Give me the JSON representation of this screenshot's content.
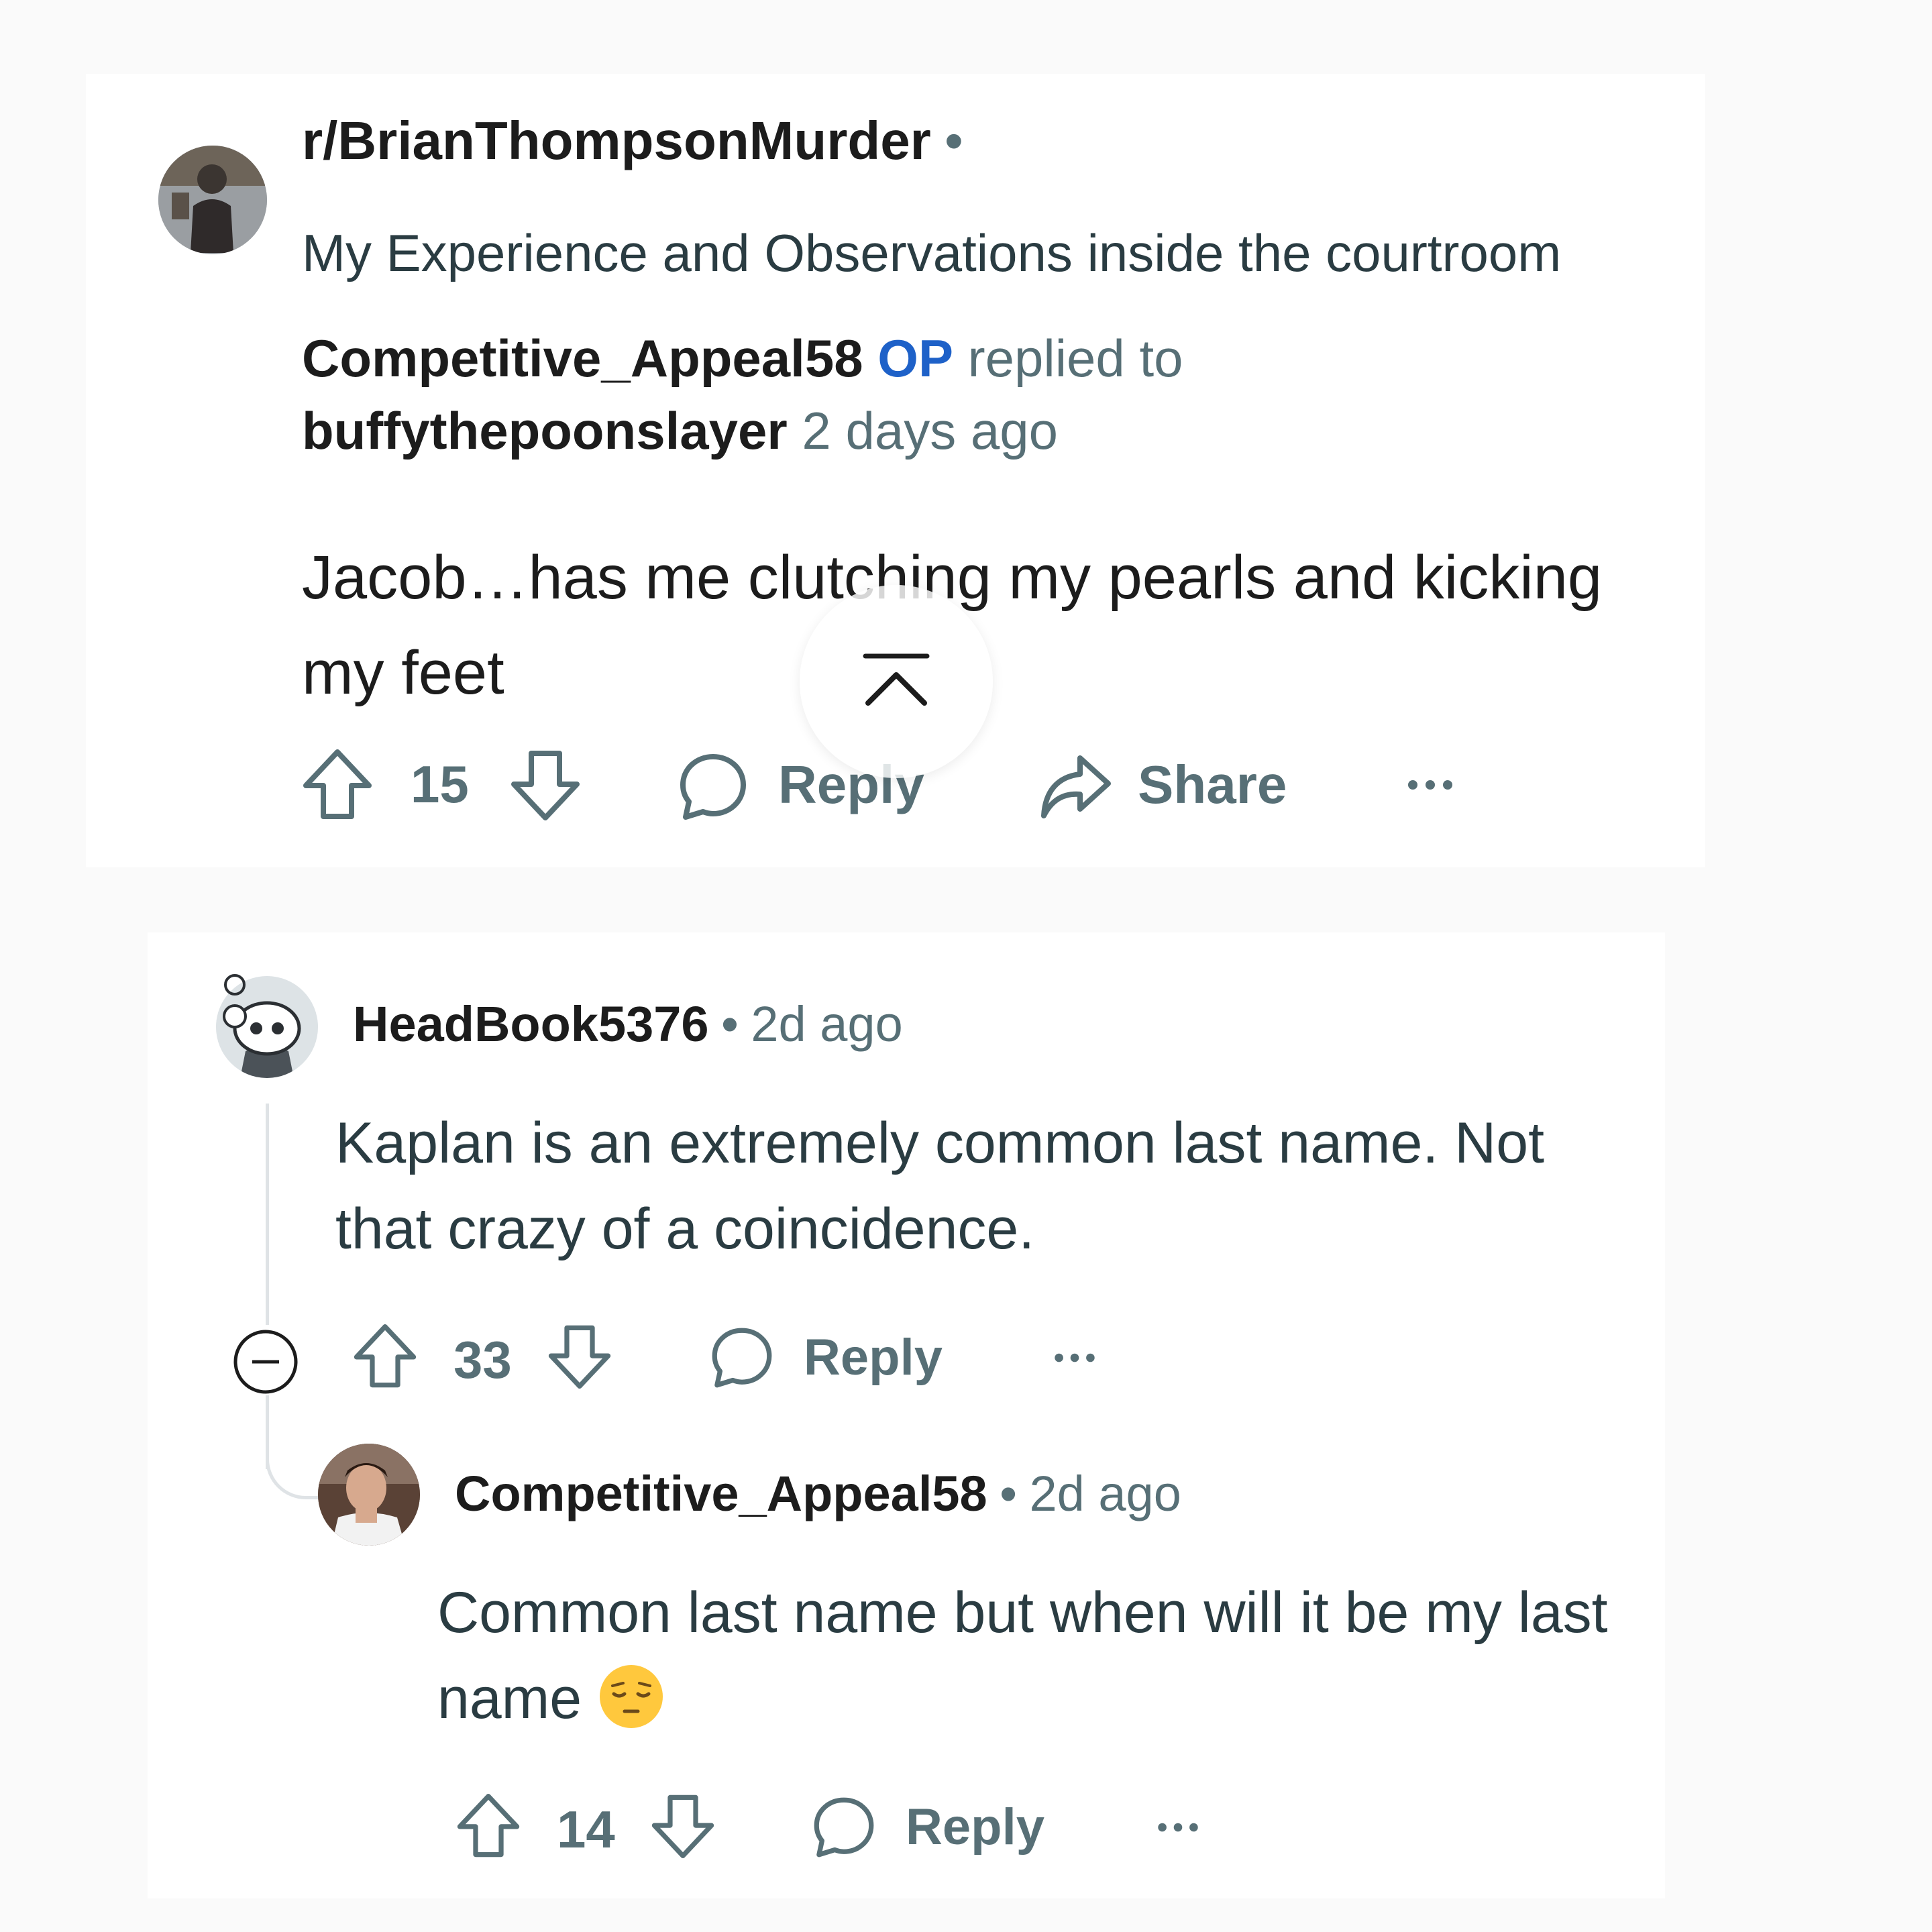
{
  "post": {
    "subreddit": "r/BrianThompsonMurder",
    "separator": "•",
    "title": "My Experience and Observations inside the courtroom",
    "author": "Competitive_Appeal58",
    "op_badge": "OP",
    "replied_to_text": "replied to",
    "replied_to_user": "buffythepoonslayer",
    "time": "2 days ago",
    "body": "Jacob…has me clutching my pearls and kicking my feet",
    "votes": "15",
    "reply_label": "Reply",
    "share_label": "Share",
    "more_icon": "more-horizontal-icon"
  },
  "comments": [
    {
      "author": "HeadBook5376",
      "separator": "•",
      "time": "2d ago",
      "body": "Kaplan is an extremely common last name. Not that crazy of a coincidence.",
      "votes": "33",
      "reply_label": "Reply"
    },
    {
      "author": "Competitive_Appeal58",
      "separator": "•",
      "time": "2d ago",
      "body": "Common last name but when will it be my last name",
      "emoji": "pensive-face",
      "votes": "14",
      "reply_label": "Reply"
    }
  ],
  "colors": {
    "background": "#fafafa",
    "card": "#ffffff",
    "op_blue": "#1e61c8",
    "meta_grey": "#576f76",
    "text": "#1c1c1c",
    "emoji_yellow": "#ffc83d"
  }
}
